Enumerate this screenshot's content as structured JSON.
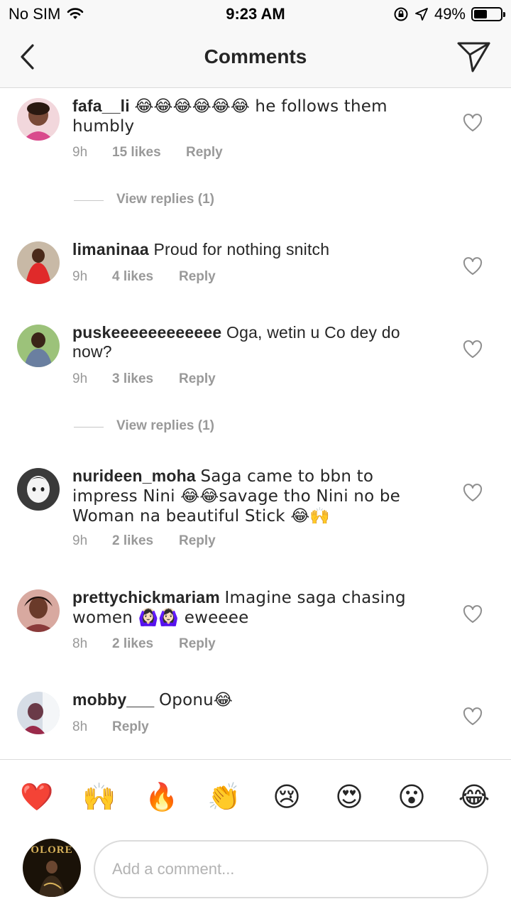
{
  "status_bar": {
    "carrier": "No SIM",
    "time": "9:23 AM",
    "battery_percent": "49%",
    "battery_level": 0.49
  },
  "nav": {
    "title": "Comments",
    "back_icon": "chevron-left-icon",
    "send_icon": "paper-plane-icon"
  },
  "comments": [
    {
      "username": "fafa__li",
      "text": "😂😂😂😂😂😂 he follows them humbly",
      "time": "9h",
      "likes": "15 likes",
      "reply": "Reply",
      "view_replies": "View replies (1)"
    },
    {
      "username": "limaninaa",
      "text": "Proud for nothing snitch",
      "time": "9h",
      "likes": "4 likes",
      "reply": "Reply"
    },
    {
      "username": "puskeeeeeeeeeeee",
      "text": "Oga, wetin u Co dey do now?",
      "time": "9h",
      "likes": "3 likes",
      "reply": "Reply",
      "view_replies": "View replies (1)"
    },
    {
      "username": "nurideen_moha",
      "text": "Saga came to bbn to impress Nini 😂😂savage tho Nini no be Woman na beautiful Stick 😂🙌",
      "time": "9h",
      "likes": "2 likes",
      "reply": "Reply"
    },
    {
      "username": "prettychickmariam",
      "text": "Imagine saga chasing women 🙆🏻‍♀️🙆🏻‍♀️ eweeee",
      "time": "8h",
      "likes": "2 likes",
      "reply": "Reply"
    },
    {
      "username": "mobby___",
      "text": "Oponu😂",
      "time": "8h",
      "reply": "Reply"
    }
  ],
  "emoji_bar": [
    "❤️",
    "🙌",
    "🔥",
    "👏",
    "😢",
    "😍",
    "😮",
    "😂"
  ],
  "composer": {
    "placeholder": "Add a comment...",
    "avatar_text": "OLORE"
  },
  "colors": {
    "text": "#262626",
    "meta": "#999999",
    "divider": "#dbdbdb",
    "nav_bg": "#f8f8f8"
  }
}
